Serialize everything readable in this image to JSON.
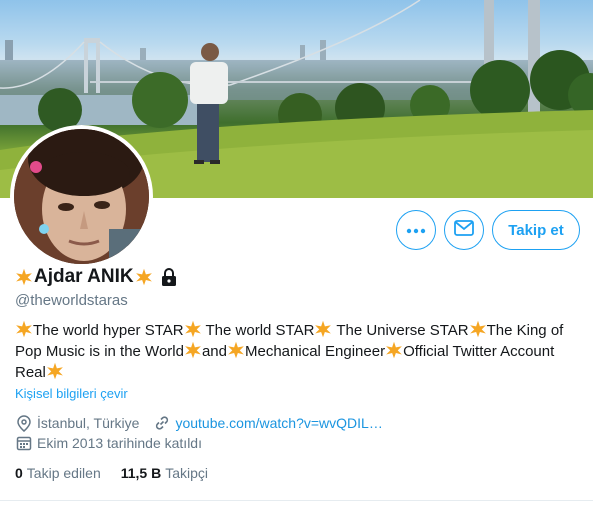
{
  "profile": {
    "display_name": "Ajdar ANIK",
    "handle": "@theworldstaras",
    "bio_segments": [
      "The world hyper STAR",
      " The world STAR",
      " The Universe STAR",
      "The King of Pop Music is in the World",
      "and",
      "Mechanical Engineer",
      "Official Twitter Account Real"
    ],
    "translate_label": "Kişisel bilgileri çevir",
    "location": "İstanbul, Türkiye",
    "website": "youtube.com/watch?v=wvQDIL…",
    "joined": "Ekim 2013 tarihinde katıldı",
    "following_count": "0",
    "following_label": "Takip edilen",
    "followers_count": "11,5 B",
    "followers_label": "Takipçi"
  },
  "actions": {
    "more_icon": "more-dots-icon",
    "message_icon": "envelope-icon",
    "follow_label": "Takip et"
  },
  "colors": {
    "accent": "#1da1f2",
    "secondary_text": "#657786",
    "star": "#f5a623"
  }
}
